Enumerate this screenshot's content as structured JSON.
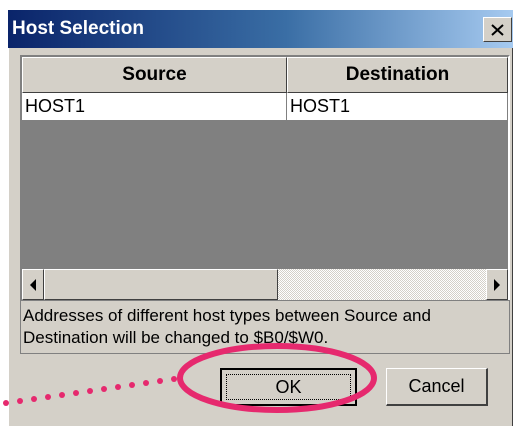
{
  "dialog": {
    "title": "Host Selection",
    "close_glyph": "X"
  },
  "grid": {
    "columns": [
      "Source",
      "Destination"
    ],
    "rows": [
      [
        "HOST1",
        "HOST1"
      ]
    ]
  },
  "message": "Addresses of different host types between Source and Destination will be changed to $B0/$W0.",
  "buttons": {
    "ok": "OK",
    "cancel": "Cancel"
  },
  "icons": {
    "close": "close-icon",
    "scroll_left": "arrow-left-icon",
    "scroll_right": "arrow-right-icon"
  },
  "colors": {
    "title_start": "#0a246a",
    "title_end": "#a6caf0",
    "dialog_face": "#d4d0c8",
    "highlight_ellipse": "#e6296e"
  }
}
